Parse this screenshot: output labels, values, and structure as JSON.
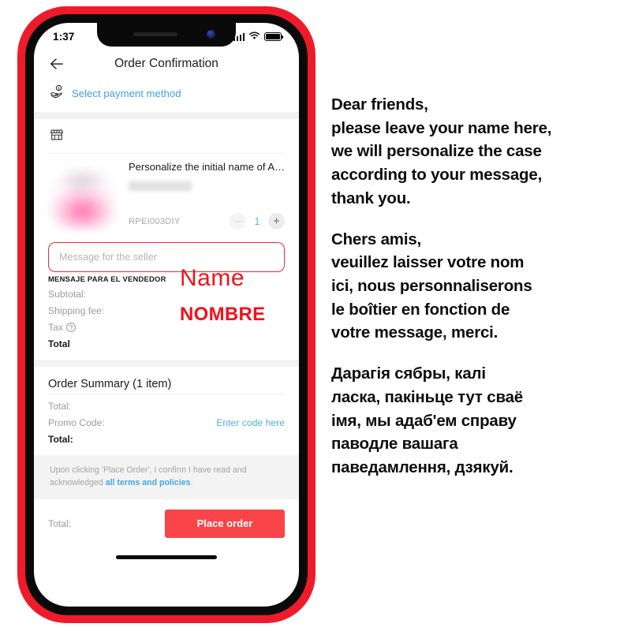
{
  "phone": {
    "statusbar": {
      "time": "1:37",
      "cellular_icon": "cellular-signal-icon",
      "wifi_icon": "wifi-icon",
      "battery_icon": "battery-icon"
    },
    "nav": {
      "back_icon": "back-arrow-icon",
      "title": "Order Confirmation"
    },
    "payment": {
      "icon": "hand-holding-money-icon",
      "label": "Select payment method"
    },
    "store": {
      "icon": "storefront-icon"
    },
    "product": {
      "image_alt": "blurred-pink-earbuds-case",
      "title": "Personalize the initial name of Ai...",
      "variant": "",
      "sku": "RPEI003DIY",
      "qty": "1",
      "minus_label": "–",
      "plus_label": "+"
    },
    "message": {
      "placeholder": "Message for the seller",
      "value": "",
      "spanish_label": "MENSAJE PARA EL VENDEDOR",
      "border_color": "#ee2b2b"
    },
    "totals": [
      {
        "label": "Subtotal:",
        "value": ""
      },
      {
        "label": "Shipping fee:",
        "value": ""
      },
      {
        "label": "Tax",
        "value": "",
        "has_help": true
      },
      {
        "label": "Total",
        "value": "",
        "bold": true
      }
    ],
    "summary": {
      "heading": "Order Summary (1 item)",
      "rows": [
        {
          "label": "Total:",
          "value": ""
        },
        {
          "label": "Promo Code:",
          "value": "Enter code here",
          "is_link": true
        },
        {
          "label": "Total:",
          "value": "",
          "bold": true
        }
      ]
    },
    "terms": {
      "text_before": "Upon clicking 'Place Order', I confirm I have read and acknowledged ",
      "link": "all terms and policies",
      "text_after": "."
    },
    "checkout": {
      "total_label": "Total:",
      "button_label": "Place order",
      "button_color": "#f9454a"
    },
    "body_color": "#ee1c2b"
  },
  "annotations": {
    "name_en": "Name",
    "name_es": "NOMBRE",
    "color": "#f0121a"
  },
  "notes": {
    "english": "Dear friends,\nplease leave your name here,\nwe will personalize the case\naccording to your message,\nthank you.",
    "french": "Chers amis,\nveuillez laisser votre nom\nici, nous personnaliserons\nle boîtier en fonction de\nvotre message, merci.",
    "belarusian": "Дарагія сябры, калі\nласка, пакіньце тут сваё\nімя, мы адаб'ем справу\nпаводле вашага\nпаведамлення, дзякуй."
  }
}
